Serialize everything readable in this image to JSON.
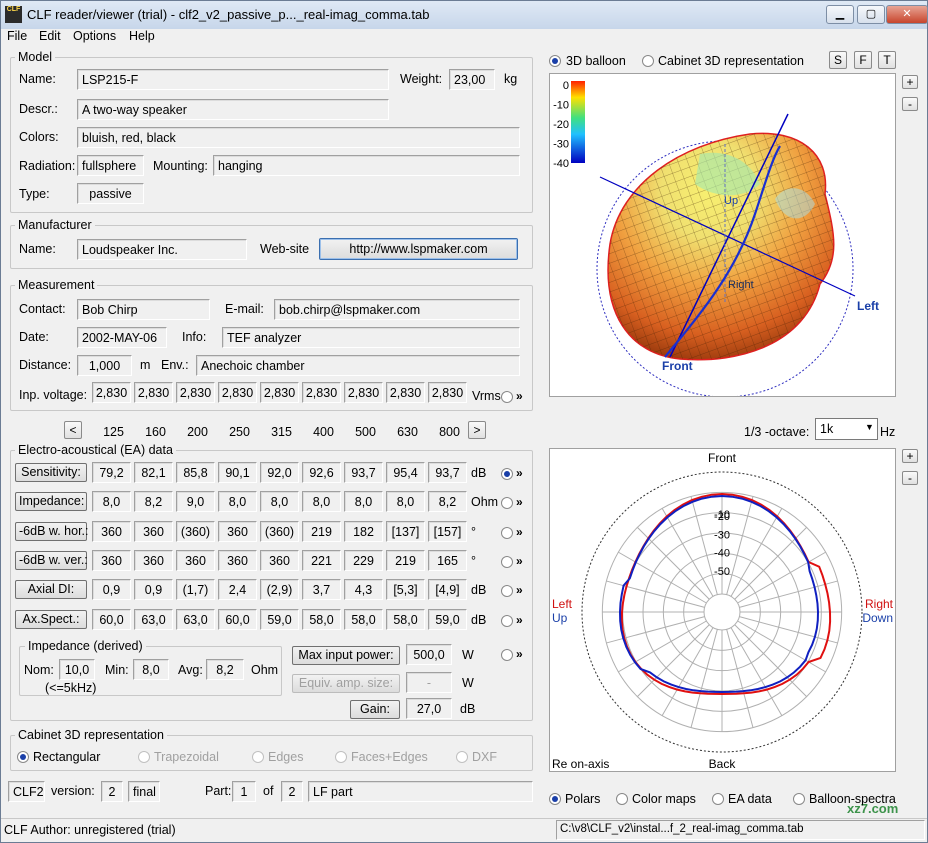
{
  "window": {
    "title": "CLF reader/viewer (trial) - clf2_v2_passive_p..._real-imag_comma.tab",
    "icon_text": "CLF",
    "min": "▁",
    "max": "▢",
    "close": "✕"
  },
  "menu": {
    "file": "File",
    "edit": "Edit",
    "options": "Options",
    "help": "Help"
  },
  "model": {
    "group": "Model",
    "name_label": "Name:",
    "name": "LSP215-F",
    "weight_label": "Weight:",
    "weight": "23,00",
    "weight_unit": "kg",
    "descr_label": "Descr.:",
    "descr": "A two-way speaker",
    "colors_label": "Colors:",
    "colors": "bluish, red, black",
    "radiation_label": "Radiation:",
    "radiation": "fullsphere",
    "mounting_label": "Mounting:",
    "mounting": "hanging",
    "type_label": "Type:",
    "type": "passive"
  },
  "manufacturer": {
    "group": "Manufacturer",
    "name_label": "Name:",
    "name": "Loudspeaker Inc.",
    "website_label": "Web-site",
    "website": "http://www.lspmaker.com"
  },
  "measurement": {
    "group": "Measurement",
    "contact_label": "Contact:",
    "contact": "Bob Chirp",
    "email_label": "E-mail:",
    "email": "bob.chirp@lspmaker.com",
    "date_label": "Date:",
    "date": "2002-MAY-06",
    "info_label": "Info:",
    "info": "TEF analyzer",
    "distance_label": "Distance:",
    "distance": "1,000",
    "distance_unit": "m",
    "env_label": "Env.:",
    "env": "Anechoic chamber",
    "voltage_label": "Inp. voltage:",
    "voltages": [
      "2,830",
      "2,830",
      "2,830",
      "2,830",
      "2,830",
      "2,830",
      "2,830",
      "2,830",
      "2,830"
    ],
    "voltage_unit": "Vrms"
  },
  "freq_nav": {
    "prev": "<",
    "next": ">",
    "freqs": [
      "125",
      "160",
      "200",
      "250",
      "315",
      "400",
      "500",
      "630",
      "800"
    ]
  },
  "ea": {
    "group": "Electro-acoustical (EA) data",
    "rows": [
      {
        "label": "Sensitivity:",
        "values": [
          "79,2",
          "82,1",
          "85,8",
          "90,1",
          "92,0",
          "92,6",
          "93,7",
          "95,4",
          "93,7"
        ],
        "unit": "dB",
        "selected": true
      },
      {
        "label": "Impedance:",
        "values": [
          "8,0",
          "8,2",
          "9,0",
          "8,0",
          "8,0",
          "8,0",
          "8,0",
          "8,0",
          "8,2"
        ],
        "unit": "Ohm",
        "selected": false
      },
      {
        "label": "-6dB w. hor.:",
        "values": [
          "360",
          "360",
          "(360)",
          "360",
          "(360)",
          "219",
          "182",
          "[137]",
          "[157]"
        ],
        "unit": "°",
        "selected": false
      },
      {
        "label": "-6dB w. ver.:",
        "values": [
          "360",
          "360",
          "360",
          "360",
          "360",
          "221",
          "229",
          "219",
          "165"
        ],
        "unit": "°",
        "selected": false
      },
      {
        "label": "Axial DI:",
        "values": [
          "0,9",
          "0,9",
          "(1,7)",
          "2,4",
          "(2,9)",
          "3,7",
          "4,3",
          "[5,3]",
          "[4,9]"
        ],
        "unit": "dB",
        "selected": false
      },
      {
        "label": "Ax.Spect.:",
        "values": [
          "60,0",
          "63,0",
          "63,0",
          "60,0",
          "59,0",
          "58,0",
          "58,0",
          "58,0",
          "59,0"
        ],
        "unit": "dB",
        "selected": false
      }
    ]
  },
  "impedance_derived": {
    "group": "Impedance (derived)",
    "nom_label": "Nom:",
    "nom": "10,0",
    "nom_note": "(<=5kHz)",
    "min_label": "Min:",
    "min": "8,0",
    "avg_label": "Avg:",
    "avg": "8,2",
    "unit": "Ohm"
  },
  "power": {
    "max_label": "Max input power:",
    "max": "500,0",
    "max_unit": "W",
    "equiv_label": "Equiv. amp. size:",
    "equiv": "-",
    "equiv_unit": "W",
    "gain_label": "Gain:",
    "gain": "27,0",
    "gain_unit": "dB"
  },
  "cabinet": {
    "group": "Cabinet 3D representation",
    "options": [
      "Rectangular",
      "Trapezoidal",
      "Edges",
      "Faces+Edges",
      "DXF"
    ]
  },
  "clf": {
    "format": "CLF2",
    "version_label": "version:",
    "version": "2",
    "status": "final",
    "part_label": "Part:",
    "part": "1",
    "of_label": "of",
    "of": "2",
    "part_name": "LF part"
  },
  "view": {
    "balloon_label": "3D balloon",
    "cabinet_label": "Cabinet 3D representation",
    "s": "S",
    "f": "F",
    "t": "T",
    "plus": "+",
    "minus": "-",
    "colorbar_ticks": [
      "0",
      "-10",
      "-20",
      "-30",
      "-40"
    ],
    "balloon_labels": {
      "up": "Up",
      "left": "Left",
      "front": "Front",
      "right": "Right"
    },
    "octave_label": "1/3 -octave:",
    "octave": "1k",
    "octave_unit": "Hz"
  },
  "polar": {
    "front": "Front",
    "back": "Back",
    "left": "Left",
    "up": "Up",
    "right": "Right",
    "down": "Down",
    "rings": [
      "-10",
      "-20",
      "-30",
      "-40",
      "-50"
    ],
    "footer": "Re on-axis"
  },
  "bottom_tabs": {
    "options": [
      "Polars",
      "Color maps",
      "EA data",
      "Balloon-spectra"
    ],
    "selected": 0
  },
  "watermark": "xz7.com",
  "status": {
    "author": "CLF Author:  unregistered (trial)",
    "path": "C:\\v8\\CLF_v2\\instal...f_2_real-imag_comma.tab"
  },
  "colors": {
    "accent": "#1a3fa8",
    "red_curve": "#e01010",
    "blue_curve": "#1020c0",
    "label_blue": "#1a3fa8"
  }
}
